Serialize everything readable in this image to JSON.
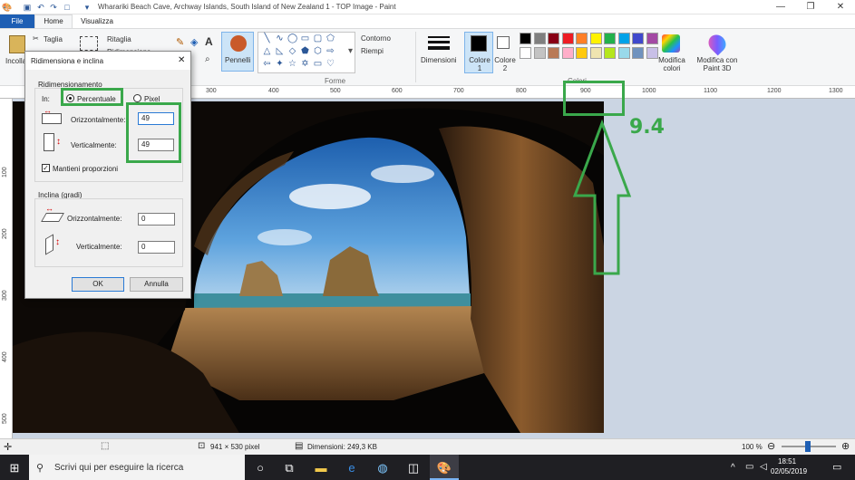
{
  "window": {
    "title": "Wharariki Beach Cave, Archway Islands, South Island of New Zealand 1 - TOP Image - Paint",
    "minimize": "—",
    "restore": "❐",
    "close": "✕"
  },
  "tabs": [
    "File",
    "Home",
    "Visualizza"
  ],
  "ribbon": {
    "paste_label": "Incolla",
    "cut_label": "Taglia",
    "crop_label": "Ritaglia",
    "resize_label": "Ridimensiona",
    "brushes_label": "Pennelli",
    "outline_label": "Contorno",
    "fill_label": "Riempi",
    "shapes_group": "Forme",
    "size_label": "Dimensioni",
    "color1_label": "Colore 1",
    "color2_label": "Colore 2",
    "edit_colors_label": "Modifica colori",
    "paint3d_label": "Modifica con Paint 3D",
    "colors_group": "Colori",
    "palette": [
      "#000000",
      "#7f7f7f",
      "#880015",
      "#ed1c24",
      "#ff7f27",
      "#fff200",
      "#22b14c",
      "#00a2e8",
      "#3f48cc",
      "#a349a4",
      "#ffffff",
      "#c3c3c3",
      "#b97a57",
      "#ffaec9",
      "#ffc90e",
      "#efe4b0",
      "#b5e61d",
      "#99d9ea",
      "#7092be",
      "#c8bfe7"
    ]
  },
  "rulers": {
    "top": [
      "300",
      "400",
      "500",
      "600",
      "700",
      "800",
      "900",
      "1000",
      "1100",
      "1200",
      "1300"
    ],
    "left": [
      "100",
      "200",
      "300",
      "400",
      "500"
    ]
  },
  "dialog": {
    "title": "Ridimensiona e inclina",
    "resize_section": "Ridimensionamento",
    "in_label": "In:",
    "percent_option": "Percentuale",
    "pixel_option": "Pixel",
    "horizontal_label": "Orizzontalmente:",
    "vertical_label": "Verticalmente:",
    "horizontal_value": "49",
    "vertical_value": "49",
    "keep_ratio_label": "Mantieni proporzioni",
    "skew_section": "Inclina (gradi)",
    "skew_horizontal_label": "Orizzontalmente:",
    "skew_vertical_label": "Verticalmente:",
    "skew_horizontal_value": "0",
    "skew_vertical_value": "0",
    "ok_label": "OK",
    "cancel_label": "Annulla"
  },
  "annotation": {
    "label": "9.4",
    "color": "#3aa84b"
  },
  "status": {
    "image_size": "941 × 530 pixel",
    "file_size": "Dimensioni: 249,3 KB",
    "zoom": "100 %"
  },
  "taskbar": {
    "search_placeholder": "Scrivi qui per eseguire la ricerca",
    "time": "18:51",
    "date": "02/05/2019"
  }
}
